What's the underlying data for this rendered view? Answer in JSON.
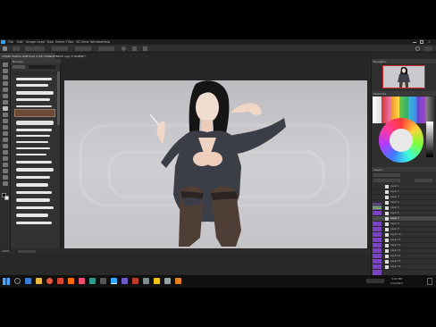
{
  "menu": {
    "items": [
      "File",
      "Edit",
      "Image",
      "Layer",
      "Type",
      "Select",
      "Filter",
      "3D",
      "View",
      "Window",
      "Help"
    ]
  },
  "document": {
    "tab_title": "CHASE WADYA LINE post 4 (25 CHANGE BACE copy 3, RGB/8) *"
  },
  "panels": {
    "navigator_title": "Navigator",
    "swatches_title": "Swatches",
    "layers_title": "Layers",
    "brushes_title": "Brushes"
  },
  "layers": [
    "Layer 1",
    "Layer 2",
    "Layer 3",
    "Layer 4",
    "Layer 5",
    "Layer 6",
    "Layer 7",
    "Layer 8",
    "Layer 9",
    "Layer 10",
    "Layer 11",
    "Layer 12",
    "Layer 13",
    "Layer 14",
    "Layer 15",
    "Layer 16"
  ],
  "status": {
    "zoom": "100%"
  },
  "taskbar": {
    "time": "3:03 PM",
    "date": "2/4/2020"
  },
  "colors": {
    "accent": "#31a8ff",
    "layer_badge": "#7a42c4",
    "canvas_bg": "#c8c7cb"
  }
}
